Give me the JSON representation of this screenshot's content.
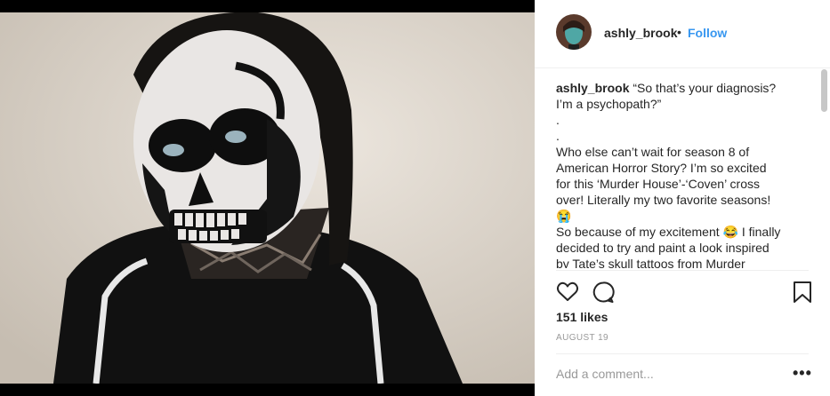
{
  "post": {
    "username": "ashly_brook",
    "follow_label": "Follow",
    "separator": "•",
    "caption_lines": [
      "“So that’s your diagnosis?",
      "I’m a psychopath?”",
      ".",
      ".",
      "Who else can’t wait for season 8 of",
      "American Horror Story? I’m so excited",
      "for this ‘Murder House’-‘Coven’ cross",
      "over! Literally my two favorite seasons!",
      "😭",
      "So because of my excitement 😂 I finally",
      "decided to try and paint a look inspired",
      "by Tate’s skull tattoos from Murder"
    ],
    "likes": "151 likes",
    "date": "AUGUST 19",
    "comment_placeholder": "Add a comment...",
    "more_label": "•••"
  },
  "icons": {
    "like": "heart-icon",
    "comment": "comment-icon",
    "save": "bookmark-icon"
  },
  "colors": {
    "link": "#3897f0",
    "text": "#262626",
    "muted": "#999999",
    "divider": "#efefef"
  }
}
